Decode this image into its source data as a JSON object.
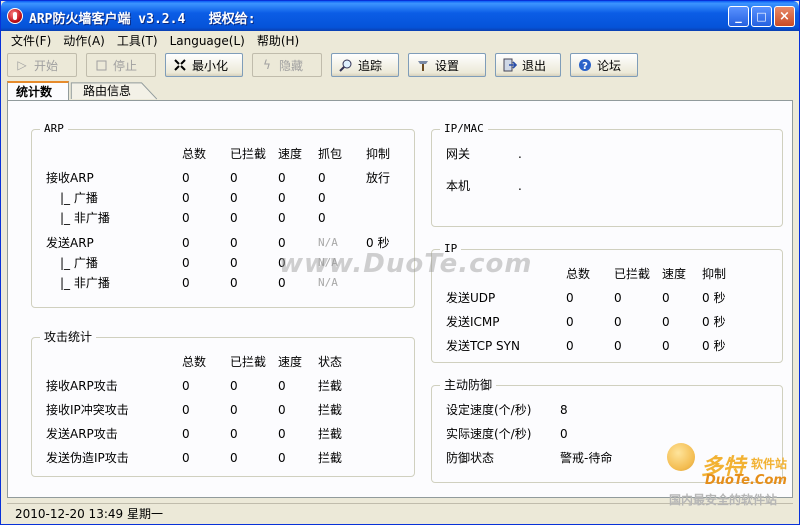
{
  "window": {
    "title": "ARP防火墙客户端 v3.2.4   授权给:",
    "min": "_",
    "max": "□",
    "close": "×"
  },
  "menu": [
    "文件(F)",
    "动作(A)",
    "工具(T)",
    "Language(L)",
    "帮助(H)"
  ],
  "toolbar": {
    "start": "开始",
    "stop": "停止",
    "minimize": "最小化",
    "hide": "隐藏",
    "trace": "追踪",
    "settings": "设置",
    "exit": "退出",
    "forum": "论坛"
  },
  "tabs": [
    "统计数据",
    "路由信息"
  ],
  "arp": {
    "title": "ARP",
    "headers": [
      "总数",
      "已拦截",
      "速度",
      "抓包",
      "抑制"
    ],
    "rows": [
      {
        "label": "接收ARP",
        "total": "0",
        "blocked": "0",
        "speed": "0",
        "capture": "0",
        "suppress": "放行"
      },
      {
        "label": "|_ 广播",
        "total": "0",
        "blocked": "0",
        "speed": "0",
        "capture": "0",
        "suppress": ""
      },
      {
        "label": "|_ 非广播",
        "total": "0",
        "blocked": "0",
        "speed": "0",
        "capture": "0",
        "suppress": ""
      },
      {
        "label": "发送ARP",
        "total": "0",
        "blocked": "0",
        "speed": "0",
        "capture": "N/A",
        "suppress": "0 秒"
      },
      {
        "label": "|_ 广播",
        "total": "0",
        "blocked": "0",
        "speed": "0",
        "capture": "N/A",
        "suppress": ""
      },
      {
        "label": "|_ 非广播",
        "total": "0",
        "blocked": "0",
        "speed": "0",
        "capture": "N/A",
        "suppress": ""
      }
    ]
  },
  "attack": {
    "title": "攻击统计",
    "headers": [
      "总数",
      "已拦截",
      "速度",
      "状态"
    ],
    "rows": [
      {
        "label": "接收ARP攻击",
        "total": "0",
        "blocked": "0",
        "speed": "0",
        "status": "拦截"
      },
      {
        "label": "接收IP冲突攻击",
        "total": "0",
        "blocked": "0",
        "speed": "0",
        "status": "拦截"
      },
      {
        "label": "发送ARP攻击",
        "total": "0",
        "blocked": "0",
        "speed": "0",
        "status": "拦截"
      },
      {
        "label": "发送伪造IP攻击",
        "total": "0",
        "blocked": "0",
        "speed": "0",
        "status": "拦截"
      }
    ]
  },
  "ipmac": {
    "title": "IP/MAC",
    "gateway_label": "网关",
    "gateway_value": ".",
    "local_label": "本机",
    "local_value": "."
  },
  "ip": {
    "title": "IP",
    "headers": [
      "总数",
      "已拦截",
      "速度",
      "抑制"
    ],
    "rows": [
      {
        "label": "发送UDP",
        "total": "0",
        "blocked": "0",
        "speed": "0",
        "suppress": "0 秒"
      },
      {
        "label": "发送ICMP",
        "total": "0",
        "blocked": "0",
        "speed": "0",
        "suppress": "0 秒"
      },
      {
        "label": "发送TCP SYN",
        "total": "0",
        "blocked": "0",
        "speed": "0",
        "suppress": "0 秒"
      }
    ]
  },
  "defense": {
    "title": "主动防御",
    "set_speed_label": "设定速度(个/秒)",
    "set_speed_value": "8",
    "actual_speed_label": "实际速度(个/秒)",
    "actual_speed_value": "0",
    "state_label": "防御状态",
    "state_value": "警戒-待命"
  },
  "status": {
    "datetime": "2010-12-20 13:49 星期一"
  },
  "watermarks": {
    "center": "www.DuoTe.com",
    "logo_cn": "多特",
    "logo_cn2": "软件站",
    "logo_en": "DuoTe.Com",
    "tagline": "国内最安全的软件站"
  }
}
